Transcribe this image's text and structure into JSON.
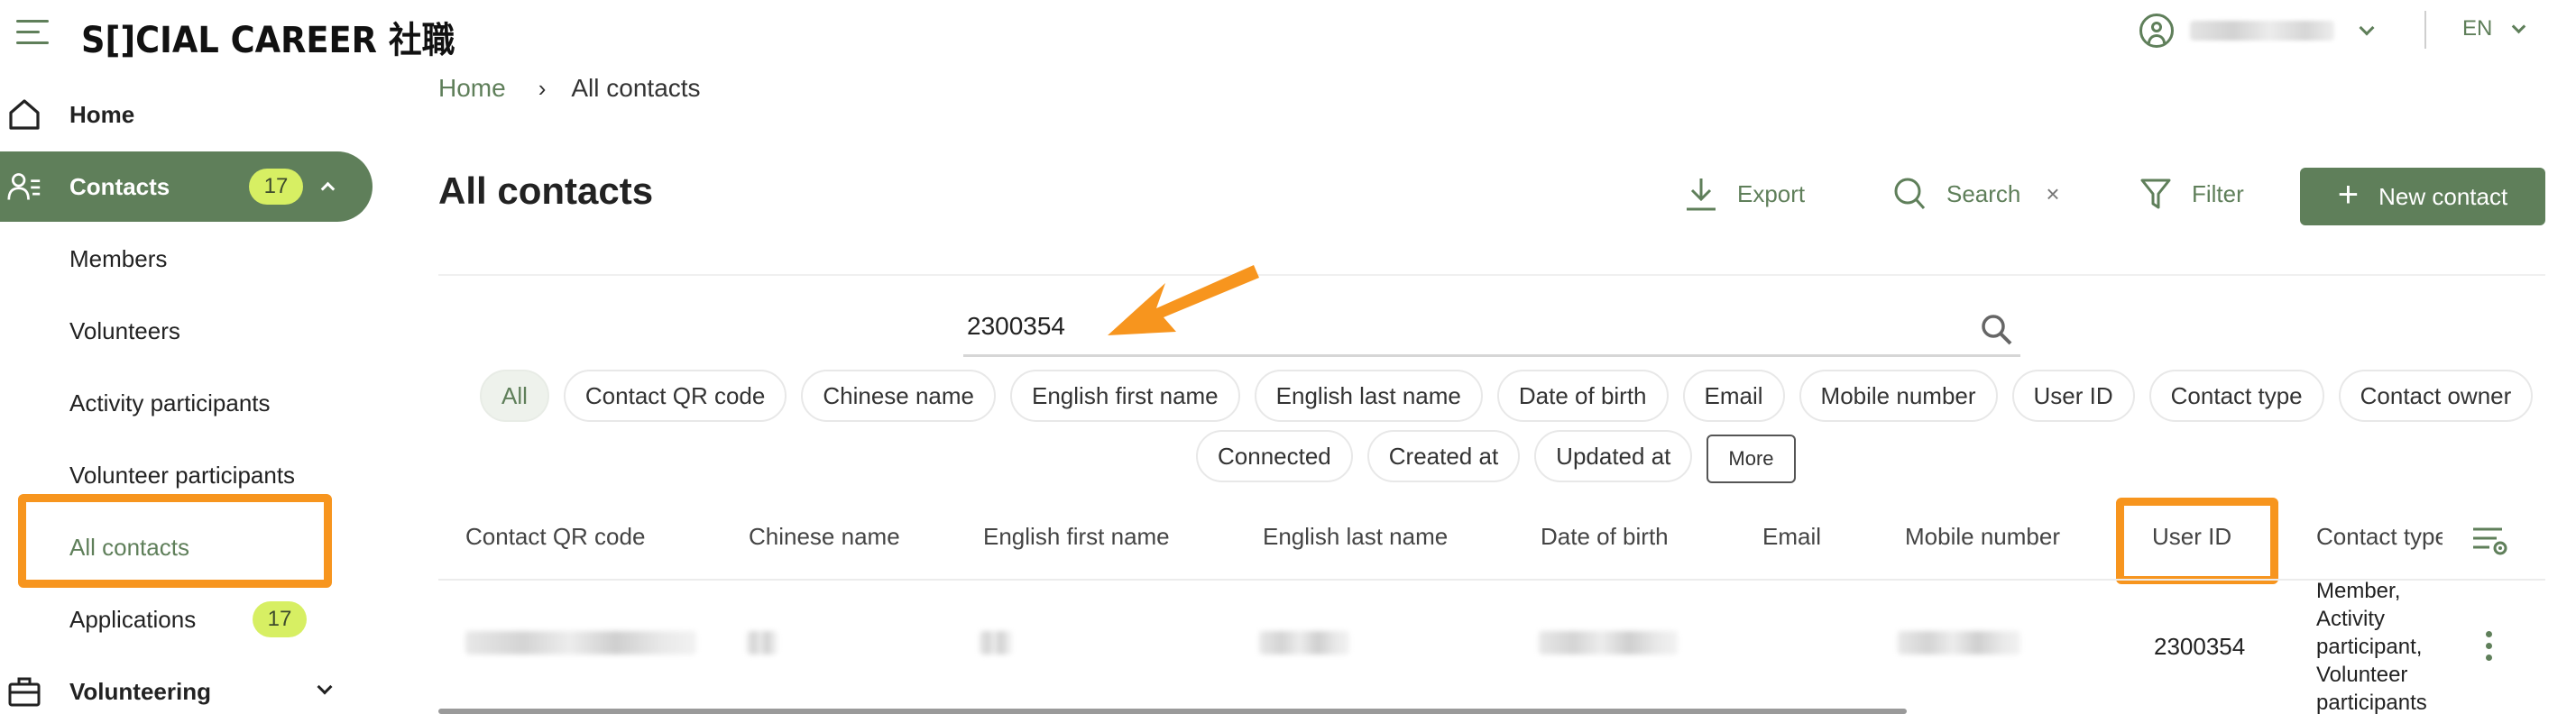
{
  "app": {
    "logo_text": "S[]CIAL CAREER 社職",
    "language": "EN"
  },
  "sidebar": {
    "home": "Home",
    "contacts": "Contacts",
    "contacts_badge": "17",
    "members": "Members",
    "volunteers": "Volunteers",
    "activity_participants": "Activity participants",
    "volunteer_participants": "Volunteer participants",
    "all_contacts": "All contacts",
    "applications": "Applications",
    "applications_badge": "17",
    "volunteering": "Volunteering"
  },
  "breadcrumb": {
    "home": "Home",
    "separator": "›",
    "current": "All contacts"
  },
  "page": {
    "title": "All contacts"
  },
  "toolbar": {
    "export": "Export",
    "search": "Search",
    "clear": "×",
    "filter": "Filter",
    "new_contact": "New contact"
  },
  "search": {
    "value": "2300354"
  },
  "filter_chips": {
    "row1": [
      "All",
      "Contact QR code",
      "Chinese name",
      "English first name",
      "English last name",
      "Date of birth",
      "Email",
      "Mobile number",
      "User ID",
      "Contact type",
      "Contact owner"
    ],
    "row2": [
      "Connected",
      "Created at",
      "Updated at"
    ],
    "more": "More"
  },
  "table": {
    "headers": {
      "qr": "Contact QR code",
      "chinese": "Chinese name",
      "first": "English first name",
      "last": "English last name",
      "dob": "Date of birth",
      "email": "Email",
      "mobile": "Mobile number",
      "user_id": "User ID",
      "type": "Contact type"
    },
    "row": {
      "user_id": "2300354",
      "contact_type": "Member, Activity participant, Volunteer participants"
    }
  },
  "colors": {
    "brand_green": "#5f7f5a",
    "badge_lime": "#d7ef63",
    "highlight_orange": "#f7951e"
  }
}
